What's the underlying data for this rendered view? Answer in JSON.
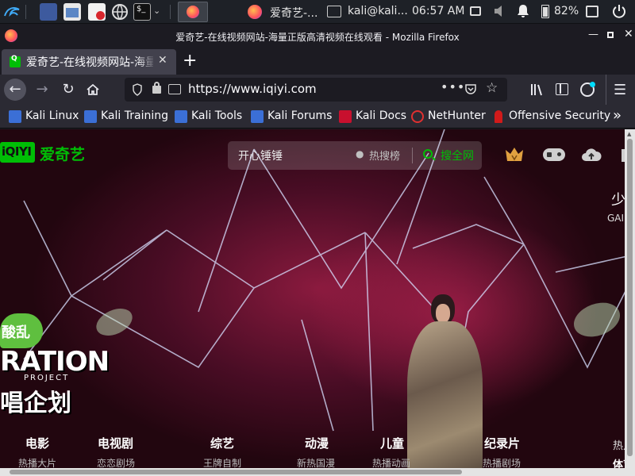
{
  "panel": {
    "task_firefox_title": "爱奇艺-...",
    "task_terminal_title": "kali@kali...",
    "clock": "06:57 AM",
    "battery": "82%"
  },
  "window": {
    "title": "爱奇艺-在线视频网站-海量正版高清视频在线观看 - Mozilla Firefox"
  },
  "tab": {
    "label": "爱奇艺-在线视频网站-海量"
  },
  "urlbar": {
    "url": "https://www.iqiyi.com"
  },
  "bookmarks": [
    {
      "label": "Kali Linux"
    },
    {
      "label": "Kali Training"
    },
    {
      "label": "Kali Tools"
    },
    {
      "label": "Kali Forums"
    },
    {
      "label": "Kali Docs"
    },
    {
      "label": "NetHunter"
    },
    {
      "label": "Offensive Security"
    }
  ],
  "site": {
    "logo_badge": "iQIYI",
    "logo_text": "爱奇艺",
    "search_placeholder": "开心锤锤",
    "hot_search": "热搜榜",
    "search_all": "搜全网",
    "promo_top": "少",
    "promo_sub": "GAI",
    "show_logo_line1": "酸乱",
    "show_logo_line2": "RATION",
    "show_logo_line3": "PROJECT",
    "show_logo_line4": "唱企划",
    "categories": [
      {
        "title": "电影",
        "sub": "热播大片"
      },
      {
        "title": "电视剧",
        "sub": "恋恋剧场"
      },
      {
        "title": "综艺",
        "sub": "王牌自制"
      },
      {
        "title": "动漫",
        "sub": "新热国漫"
      },
      {
        "title": "儿童",
        "sub": "热播动画"
      },
      {
        "title": "纪录片",
        "sub": "热播剧场"
      },
      {
        "title": "热点",
        "sub": "体育"
      }
    ]
  },
  "colors": {
    "iqiyi_green": "#00be06",
    "firefox_dark": "#1c1b22",
    "toolbar": "#2b2a33"
  }
}
